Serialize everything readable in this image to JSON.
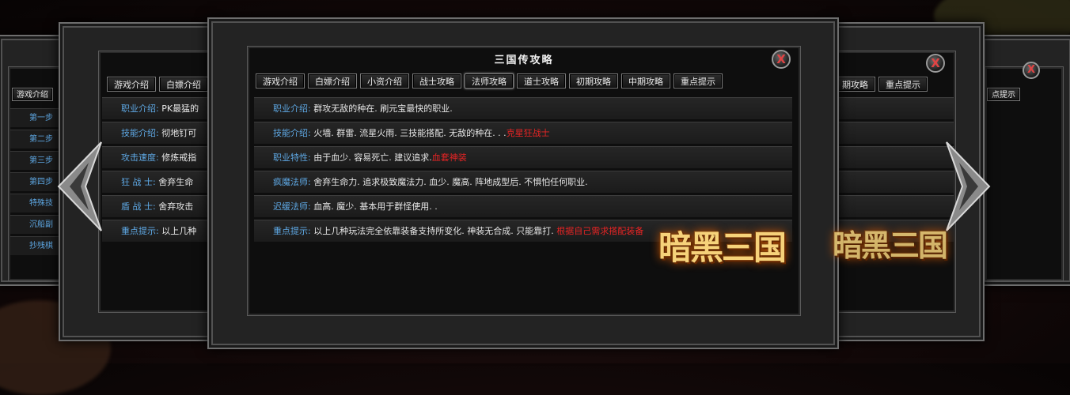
{
  "main": {
    "title": "三国传攻略",
    "tabs": [
      "游戏介绍",
      "白嫖介绍",
      "小资介绍",
      "战士攻略",
      "法师攻略",
      "道士攻略",
      "初期攻略",
      "中期攻略",
      "重点提示"
    ],
    "rows": [
      {
        "label": "职业介绍:",
        "text": "群攻无敌的种在. 刷元宝最快的职业.",
        "hot": ""
      },
      {
        "label": "技能介绍:",
        "text": "火墙. 群雷. 流星火雨. 三技能搭配. 无敌的种在. . .",
        "hot": "克星狂战士"
      },
      {
        "label": "职业特性:",
        "text": "由于血少. 容易死亡. 建议追求.",
        "hot": "血套神装"
      },
      {
        "label": "疯魔法师:",
        "text": "舍弃生命力. 追求极致魔法力. 血少. 魔高. 阵地成型后. 不惧怕任何职业.",
        "hot": ""
      },
      {
        "label": "迟缓法师:",
        "text": "血高. 魔少. 基本用于群怪使用. .",
        "hot": ""
      },
      {
        "label": "重点提示:",
        "text": "以上几种玩法完全依靠装备支持所变化. 神装无合成. 只能靠打.",
        "hot": "根据自己需求搭配装备"
      }
    ],
    "close": "X"
  },
  "left_mid": {
    "tabs": [
      "游戏介绍",
      "白嫖介绍"
    ],
    "rows": [
      {
        "label": "职业介绍:",
        "text": "PK最猛的"
      },
      {
        "label": "技能介绍:",
        "text": "彻地钉可"
      },
      {
        "label": "攻击速度:",
        "text": "修炼戒指"
      },
      {
        "label": "狂 战 士:",
        "text": "舍弃生命"
      },
      {
        "label": "盾 战 士:",
        "text": "舍弃攻击"
      },
      {
        "label": "重点提示:",
        "text": "以上几种"
      }
    ]
  },
  "left_back": {
    "tab": "游戏介绍",
    "items": [
      "第一步",
      "第二步",
      "第三步",
      "第四步",
      "特殊技",
      "沉船副",
      "抄残棋"
    ]
  },
  "right_mid": {
    "tabs": [
      "期攻略",
      "重点提示"
    ],
    "close": "X"
  },
  "right_back": {
    "tab": "点提示",
    "close": "X"
  },
  "logo": {
    "text": "暗黑三国"
  },
  "colors": {
    "label": "#5ea8e4",
    "hot": "#e82424",
    "text": "#e6e6e6"
  }
}
